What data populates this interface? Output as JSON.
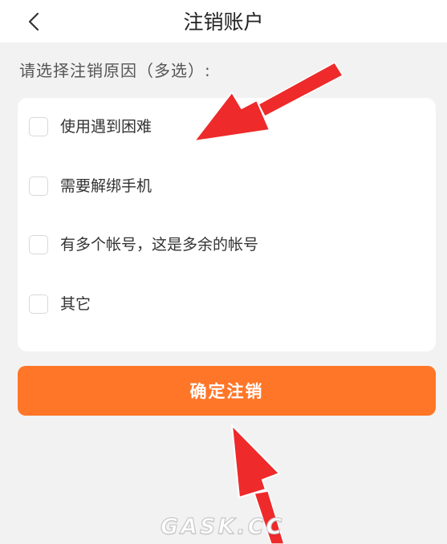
{
  "header": {
    "back_icon": "chevron-left-icon",
    "title": "注销账户"
  },
  "reasons": {
    "prompt": "请选择注销原因（多选）:",
    "options": [
      {
        "label": "使用遇到困难",
        "checked": false
      },
      {
        "label": "需要解绑手机",
        "checked": false
      },
      {
        "label": "有多个帐号，这是多余的帐号",
        "checked": false
      },
      {
        "label": "其它",
        "checked": false
      }
    ]
  },
  "confirm_button": {
    "label": "确定注销",
    "color": "#ff7628"
  },
  "annotations": {
    "arrow_color": "#ee2a2a",
    "arrow_icons": [
      "red-arrow-icon",
      "red-arrow-icon"
    ]
  },
  "watermark": {
    "text": "GASK.CC"
  }
}
